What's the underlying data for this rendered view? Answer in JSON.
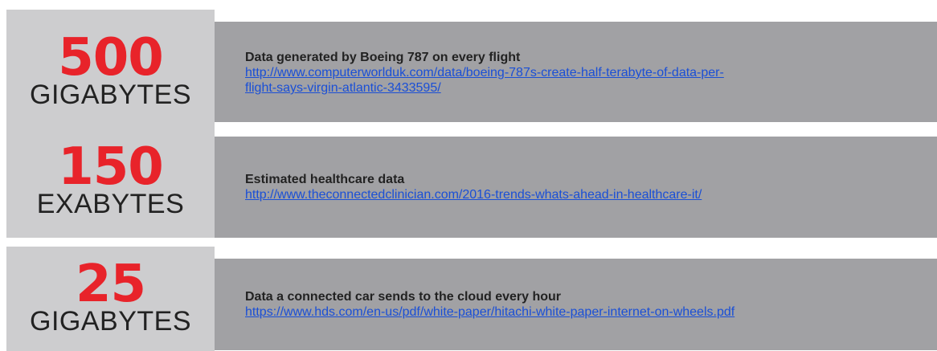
{
  "stats": [
    {
      "number": "500",
      "unit": "GIGABYTES",
      "title": "Data generated by Boeing 787 on every flight",
      "link": "http://www.computerworlduk.com/data/boeing-787s-create-half-terabyte-of-data-per-flight-says-virgin-atlantic-3433595/"
    },
    {
      "number": "150",
      "unit": "EXABYTES",
      "title": "Estimated healthcare data",
      "link": "http://www.theconnectedclinician.com/2016-trends-whats-ahead-in-healthcare-it/"
    },
    {
      "number": "25",
      "unit": "GIGABYTES",
      "title": "Data a connected car sends to the cloud every hour",
      "link": "https://www.hds.com/en-us/pdf/white-paper/hitachi-white-paper-internet-on-wheels.pdf"
    }
  ],
  "colors": {
    "accent": "#e8232a",
    "stat_bg": "#cdcdcf",
    "desc_bg": "#a1a1a4",
    "link": "#1a4fd6"
  }
}
